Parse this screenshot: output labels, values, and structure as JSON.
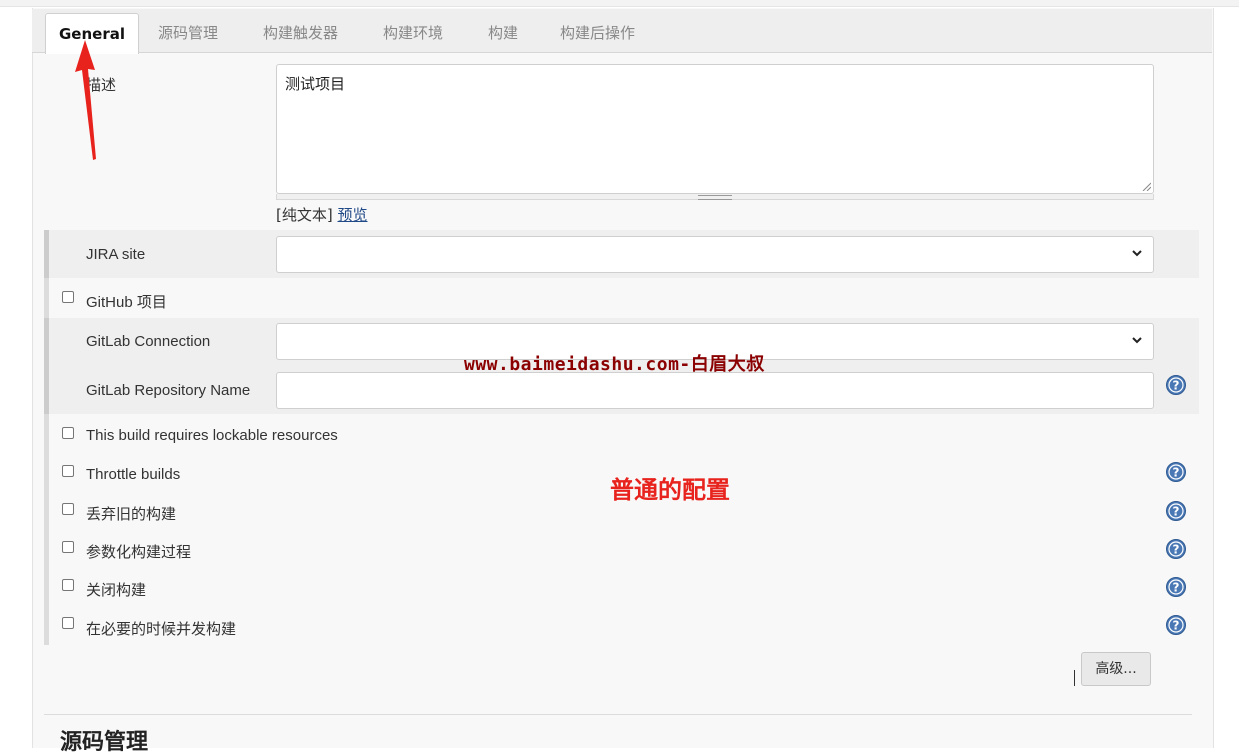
{
  "tabs": [
    {
      "label": "General",
      "active": true
    },
    {
      "label": "源码管理"
    },
    {
      "label": "构建触发器"
    },
    {
      "label": "构建环境"
    },
    {
      "label": "构建"
    },
    {
      "label": "构建后操作"
    }
  ],
  "description": {
    "label": "描述",
    "value": "测试项目",
    "format_plain": "[纯文本]",
    "preview_link": "预览"
  },
  "jira": {
    "label": "JIRA site",
    "selected": ""
  },
  "github": {
    "label": "GitHub 项目",
    "checked": false
  },
  "gitlab": {
    "connection_label": "GitLab Connection",
    "connection_selected": "",
    "repo_label": "GitLab Repository Name",
    "repo_value": ""
  },
  "options": [
    {
      "label": "This build requires lockable resources",
      "checked": false
    },
    {
      "label": "Throttle builds",
      "checked": false
    },
    {
      "label": "丢弃旧的构建",
      "checked": false
    },
    {
      "label": "参数化构建过程",
      "checked": false
    },
    {
      "label": "关闭构建",
      "checked": false
    },
    {
      "label": "在必要的时候并发构建",
      "checked": false
    }
  ],
  "advanced_button": "高级...",
  "next_section_heading": "源码管理",
  "overlay": {
    "watermark": "www.baimeidashu.com-白眉大叔",
    "annotation": "普通的配置",
    "annotation_color": "#e8231d",
    "watermark_color": "#8b0000"
  },
  "colors": {
    "help_icon": "#4a78b5",
    "link": "#204a87"
  }
}
